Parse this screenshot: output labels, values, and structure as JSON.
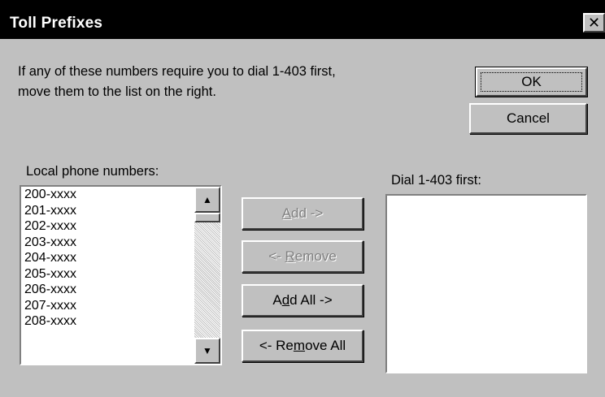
{
  "window": {
    "title": "Toll Prefixes",
    "close_glyph": "✕"
  },
  "instruction": {
    "line1": "If any of these numbers require you to dial 1-403 first,",
    "line2": "move them to the list on the right."
  },
  "dialog_buttons": {
    "ok": "OK",
    "cancel": "Cancel"
  },
  "local_list": {
    "label": "Local phone numbers:",
    "items": [
      "200-xxxx",
      "201-xxxx",
      "202-xxxx",
      "203-xxxx",
      "204-xxxx",
      "205-xxxx",
      "206-xxxx",
      "207-xxxx",
      "208-xxxx"
    ]
  },
  "move_buttons": {
    "add": {
      "label_pre": "",
      "mnemonic": "A",
      "label_post": "dd ->",
      "enabled": false
    },
    "remove": {
      "label_pre": "<- ",
      "mnemonic": "R",
      "label_post": "emove",
      "enabled": false
    },
    "add_all": {
      "label_pre": "A",
      "mnemonic": "d",
      "label_post": "d All ->",
      "enabled": true
    },
    "remove_all": {
      "label_pre": "<- Re",
      "mnemonic": "m",
      "label_post": "ove All",
      "enabled": true
    }
  },
  "dial_list": {
    "label": "Dial 1-403 first:",
    "items": []
  },
  "scrollbar": {
    "up_icon": "scroll-up-arrow-icon",
    "down_icon": "scroll-down-arrow-icon"
  },
  "colors": {
    "face": "#c0c0c0",
    "title_bar": "#000000",
    "disabled_text": "#808080"
  }
}
